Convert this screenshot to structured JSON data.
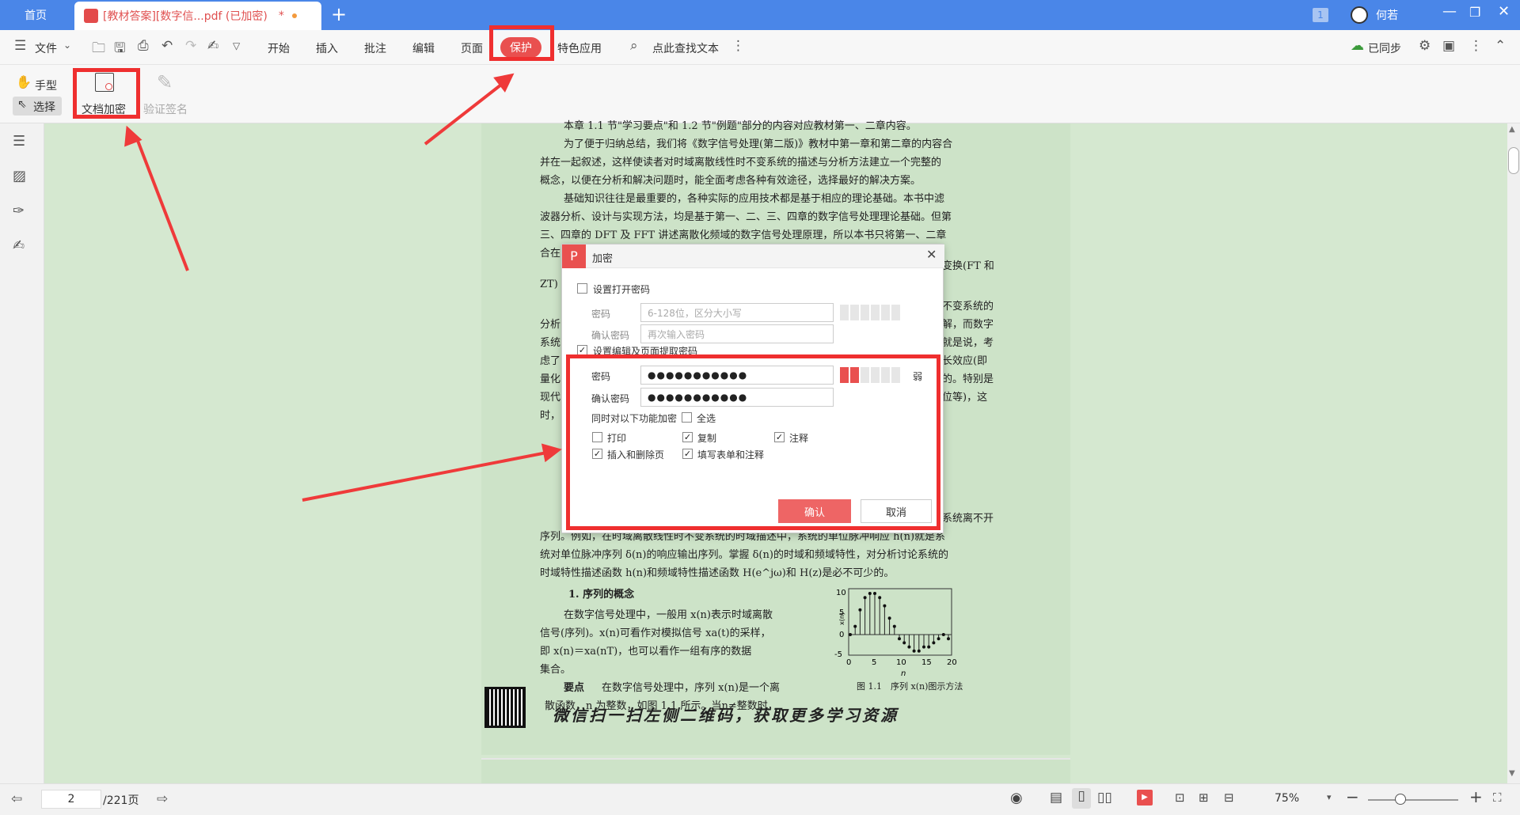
{
  "titlebar": {
    "home_tab": "首页",
    "doc_tab": "[教材答案][数字信...pdf (已加密)",
    "doc_modified_mark": "*",
    "new_tab": "+",
    "count_badge": "1",
    "user_name": "何若"
  },
  "menubar": {
    "file": "文件",
    "items": [
      "开始",
      "插入",
      "批注",
      "编辑",
      "页面",
      "保护",
      "特色应用"
    ],
    "active": "保护",
    "search": "点此查找文本",
    "sync": "已同步"
  },
  "ribbon": {
    "hand": "手型",
    "select": "选择",
    "encrypt": "文档加密",
    "verify": "验证签名"
  },
  "document": {
    "lines": [
      "本章 1.1 节\"学习要点\"和 1.2 节\"例题\"部分的内容对应教材第一、二章内容。",
      "为了便于归纳总结，我们将《数字信号处理(第二版)》教材中第一章和第二章的内容合",
      "并在一起叙述，这样使读者对时域离散线性时不变系统的描述与分析方法建立一个完整的",
      "概念，以便在分析和解决问题时，能全面考虑各种有效途径，选择最好的解决方案。",
      "基础知识往往是最重要的，各种实际的应用技术都是基于相应的理论基础。本书中滤",
      "波器分析、设计与实现方法，均是基于第一、二、三、四章的数字信号处理理论基础。但第",
      "三、四章的 DFT 及 FFT 讲述离散化频域的数字信号处理原理，所以本书只将第一、二章",
      "合在"
    ],
    "right_fragments": [
      "变换(FT 和",
      "不变系统的",
      "解，而数字",
      "就是说，考",
      "长效应(即",
      "的。特别是",
      "位等)，这"
    ],
    "left_fragments": [
      "ZT)",
      "分析",
      "系统",
      "虑了",
      "量化",
      "现代",
      "时，"
    ],
    "lines2": [
      "系统离不开",
      "序列。例如，在时域离散线性时不变系统的时域描述中，系统的单位脉冲响应 h(n)就是系",
      "统对单位脉冲序列 δ(n)的响应输出序列。掌握 δ(n)的时域和频域特性，对分析讨论系统的",
      "时域特性描述函数 h(n)和频域特性描述函数 H(e^jω)和 H(z)是必不可少的。"
    ],
    "section": "1. 序列的概念",
    "para": [
      "在数字信号处理中，一般用 x(n)表示时域离散",
      "信号(序列)。x(n)可看作对模拟信号 xa(t)的采样，",
      "即 x(n)＝xa(nT)，也可以看作一组有序的数据",
      "集合。"
    ],
    "key_label": "要点",
    "key_text": "在数字信号处理中，序列 x(n)是一个离",
    "key_text2": "散函数，n 为整数，如图 1.1 所示。当n≠整数时，",
    "figure_caption": "图 1.1　序列 x(n)图示方法",
    "footer_banner": "微信扫一扫左侧二维码，获取更多学习资源",
    "figure": {
      "yticks": [
        "10",
        "5",
        "0",
        "-5"
      ],
      "xticks": [
        "0",
        "5",
        "10",
        "15",
        "20"
      ],
      "xlabel": "n",
      "ylabel": "x(n)"
    }
  },
  "dialog": {
    "title": "加密",
    "open_pw_label": "设置打开密码",
    "pw_label": "密码",
    "pw_placeholder": "6-128位，区分大小写",
    "confirm_label": "确认密码",
    "confirm_placeholder": "再次输入密码",
    "edit_pw_label": "设置编辑及页面提取密码",
    "edit_pw_value": "●●●●●●●●●●●",
    "edit_confirm_value": "●●●●●●●●●●●",
    "strength_text": "弱",
    "also_encrypt": "同时对以下功能加密",
    "select_all": "全选",
    "options": [
      {
        "label": "打印",
        "checked": false
      },
      {
        "label": "复制",
        "checked": true
      },
      {
        "label": "注释",
        "checked": true
      },
      {
        "label": "插入和删除页",
        "checked": true
      },
      {
        "label": "填写表单和注释",
        "checked": true
      }
    ],
    "ok": "确认",
    "cancel": "取消"
  },
  "bottombar": {
    "page_current": "2",
    "page_total": "/221页",
    "zoom": "75%"
  },
  "colors": {
    "titlebar": "#4a86e8",
    "accent": "#e9504f",
    "page_bg": "#cde3c8",
    "annotation": "#ef2f2f"
  }
}
